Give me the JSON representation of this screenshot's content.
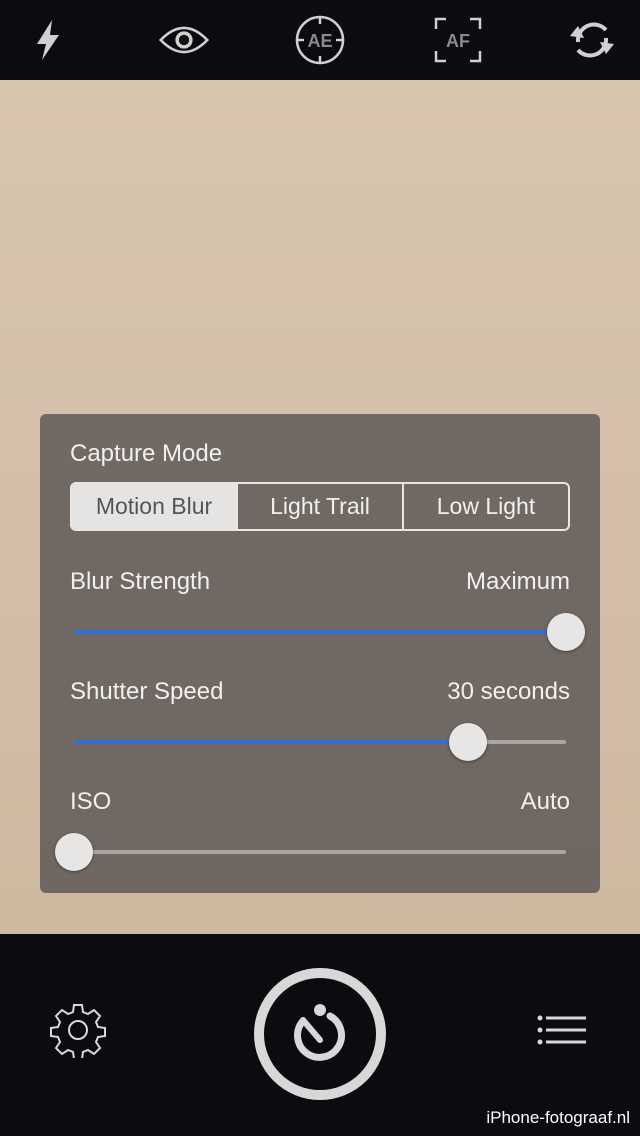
{
  "toolbar": {
    "items": [
      {
        "icon": "flash-icon"
      },
      {
        "icon": "eye-icon"
      },
      {
        "icon": "ae-lock-icon",
        "label": "AE"
      },
      {
        "icon": "af-lock-icon",
        "label": "AF"
      },
      {
        "icon": "switch-camera-icon"
      }
    ]
  },
  "panel": {
    "capture_mode_label": "Capture Mode",
    "modes": [
      "Motion Blur",
      "Light Trail",
      "Low Light"
    ],
    "selected_mode": "Motion Blur",
    "blur": {
      "label": "Blur Strength",
      "value_text": "Maximum",
      "level": 1.0
    },
    "shutter": {
      "label": "Shutter Speed",
      "value_text": "30 seconds",
      "level": 0.8
    },
    "iso": {
      "label": "ISO",
      "value_text": "Auto",
      "level": 0.0
    }
  },
  "bottom": {
    "settings_icon": "gear-icon",
    "shutter_icon": "timer-icon",
    "menu_icon": "list-icon"
  },
  "watermark": "iPhone-fotograaf.nl",
  "colors": {
    "accent": "#2f6ed6",
    "bar": "#0b0c10"
  }
}
